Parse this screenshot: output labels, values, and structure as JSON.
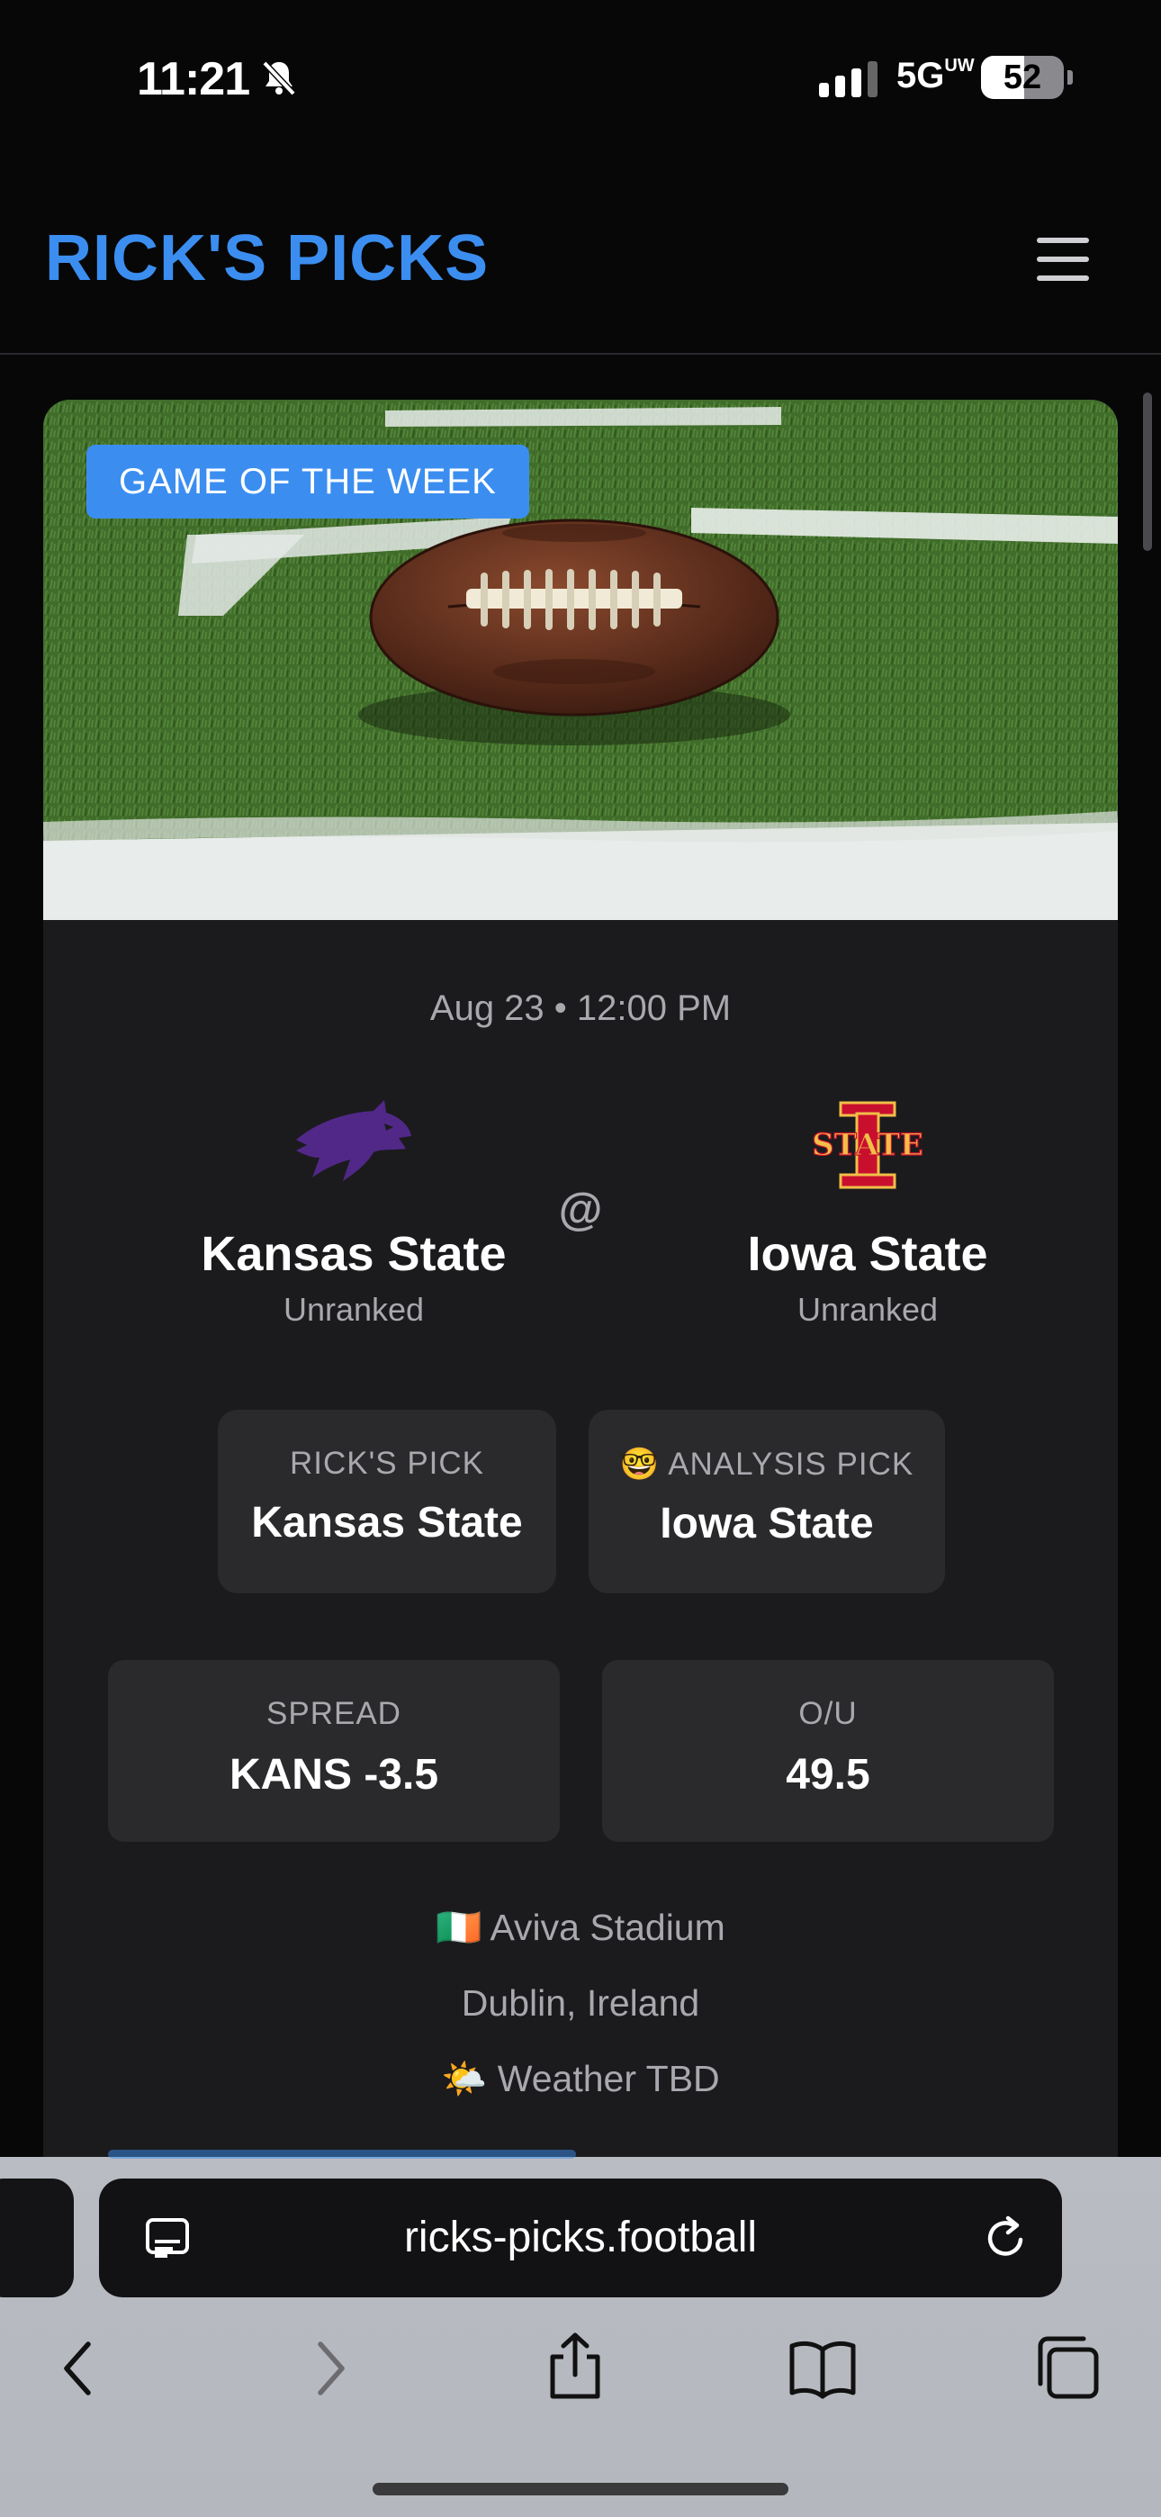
{
  "status": {
    "time": "11:21",
    "network": "5G",
    "network_sup": "UW",
    "battery": "52",
    "battery_level": 0.52
  },
  "header": {
    "brand": "RICK'S PICKS"
  },
  "game": {
    "badge": "GAME OF THE WEEK",
    "datetime": "Aug 23 • 12:00 PM",
    "at": "@",
    "away": {
      "name": "Kansas State",
      "rank": "Unranked",
      "logo": "wildcat-logo",
      "color": "#512888"
    },
    "home": {
      "name": "Iowa State",
      "rank": "Unranked",
      "logo": "cyclones-state-logo",
      "color": "#C8102E"
    },
    "ricks_pick": {
      "label": "RICK'S PICK",
      "value": "Kansas State"
    },
    "analysis_pick": {
      "emoji": "🤓",
      "label": "ANALYSIS PICK",
      "value": "Iowa State"
    },
    "spread": {
      "label": "SPREAD",
      "value": "KANS -3.5"
    },
    "ou": {
      "label": "O/U",
      "value": "49.5"
    },
    "venue": {
      "flag": "🇮🇪",
      "stadium": "Aviva Stadium",
      "city": "Dublin, Ireland",
      "weather_icon": "🌤️",
      "weather": "Weather TBD"
    }
  },
  "browser": {
    "url": "ricks-picks.football"
  },
  "colors": {
    "accent": "#3b8ef0",
    "background": "#070708",
    "card": "#1b1b1d",
    "tile": "#2a2a2c"
  }
}
